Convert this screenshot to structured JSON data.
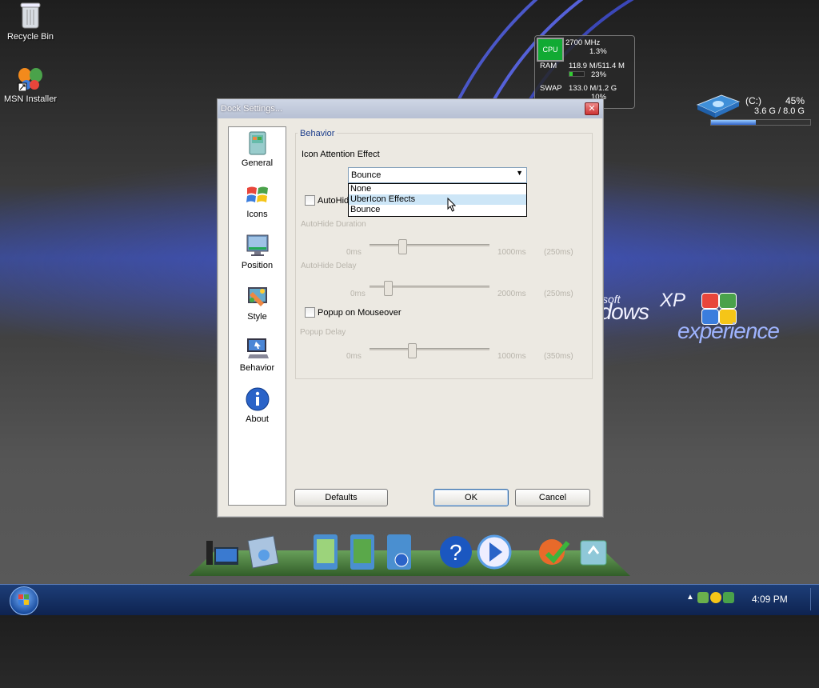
{
  "desktop": {
    "icons": [
      {
        "label": "Recycle Bin"
      },
      {
        "label": "MSN Installer"
      }
    ]
  },
  "sysmon": {
    "cpu_box": "CPU",
    "cpu_freq": "2700 MHz",
    "cpu_pct": "1.3%",
    "ram_label": "RAM",
    "ram_value": "118.9 M/511.4 M",
    "ram_pct": "23%",
    "ram_fraction": 0.23,
    "swap_label": "SWAP",
    "swap_value": "133.0 M/1.2 G",
    "swap_pct": "10%"
  },
  "drive": {
    "name": "(C:)",
    "pct": "45%",
    "size": "3.6 G / 8.0 G",
    "fraction": 0.45
  },
  "xp_logo": {
    "line1": "soft",
    "line2": "ndows",
    "line3": "XP",
    "line4": "experience"
  },
  "dialog": {
    "title": "Dock Settings...",
    "close_glyph": "✕",
    "sidebar": [
      {
        "label": "General",
        "icon": "general-icon"
      },
      {
        "label": "Icons",
        "icon": "windows-flag-icon"
      },
      {
        "label": "Position",
        "icon": "monitor-icon"
      },
      {
        "label": "Style",
        "icon": "palette-icon"
      },
      {
        "label": "Behavior",
        "icon": "computer-icon"
      },
      {
        "label": "About",
        "icon": "info-icon"
      }
    ],
    "group_label": "Behavior",
    "attention_label": "Icon Attention Effect",
    "attention_value": "Bounce",
    "attention_options": [
      "None",
      "UberIcon Effects",
      "Bounce"
    ],
    "attention_highlighted": "UberIcon Effects",
    "autohide_label": "AutoHide",
    "autohide_duration_label": "AutoHide Duration",
    "autohide_duration_min": "0ms",
    "autohide_duration_max": "1000ms",
    "autohide_duration_value": "(250ms)",
    "autohide_delay_label": "AutoHide Delay",
    "autohide_delay_min": "0ms",
    "autohide_delay_max": "2000ms",
    "autohide_delay_value": "(250ms)",
    "popup_label": "Popup on Mouseover",
    "popup_delay_label": "Popup Delay",
    "popup_delay_min": "0ms",
    "popup_delay_max": "1000ms",
    "popup_delay_value": "(350ms)",
    "defaults_button": "Defaults",
    "ok_button": "OK",
    "cancel_button": "Cancel"
  },
  "dock": {
    "items": [
      "computer-icon",
      "remote-desktop-icon",
      "documents-icon",
      "music-icon",
      "videos-icon",
      "help-icon",
      "media-player-icon",
      "windows-update-icon",
      "recycle-icon"
    ]
  },
  "taskbar": {
    "clock": "4:09 PM",
    "tray_arrow": "▲"
  },
  "colors": {
    "accent": "#1a3c8a",
    "dropdown_highlight": "#cde6f7",
    "taskbar": "#1d3e78"
  }
}
